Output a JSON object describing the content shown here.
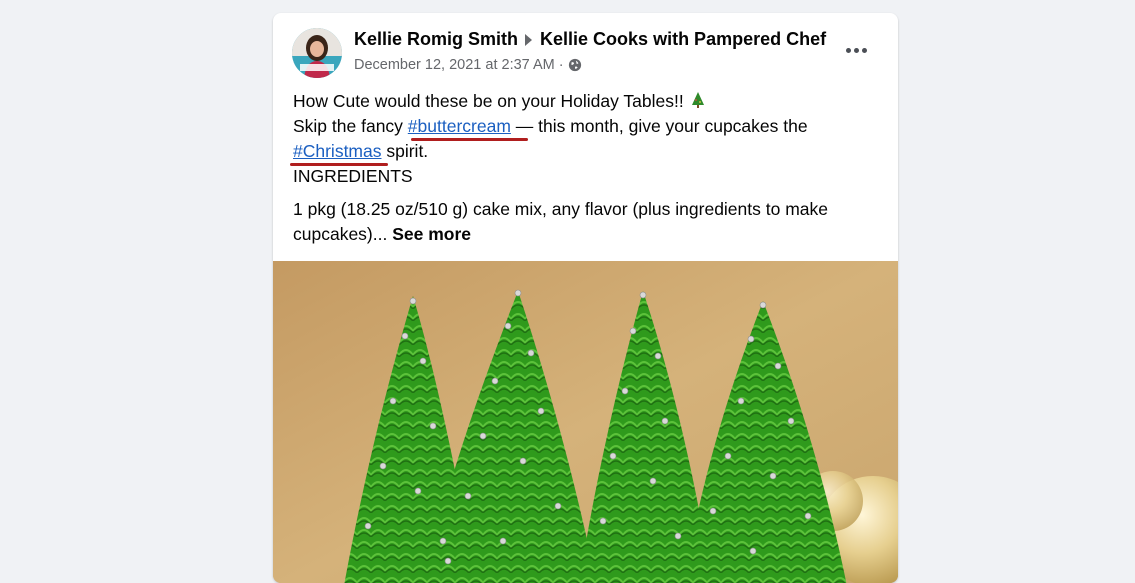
{
  "post": {
    "author": "Kellie Romig Smith",
    "group": "Kellie Cooks with Pampered Chef",
    "timestamp": "December 12, 2021 at 2:37 AM",
    "separator": "·",
    "privacy_icon": "globe-icon",
    "more_icon": "more-options-icon",
    "avatar_icon": "profile-avatar"
  },
  "content": {
    "line1": "How Cute would these be on your Holiday Tables!!",
    "line1_emoji": "christmas-tree-icon",
    "line2_pre": "Skip the fancy ",
    "hashtag1": "#buttercream",
    "line2_post": " — this month, give your cupcakes the",
    "hashtag2": "#Christmas",
    "line3_post": " spirit.",
    "line4": "INGREDIENTS",
    "para2_text": "1 pkg (18.25 oz/510 g) cake mix, any flavor (plus ingredients to make cupcakes)... ",
    "see_more": "See more"
  },
  "colors": {
    "hashtag": "#1b5fc1",
    "underline_annotation": "#b01e1e",
    "tree_green": "#2f9a1c",
    "background_tan": "#c8a46c"
  }
}
